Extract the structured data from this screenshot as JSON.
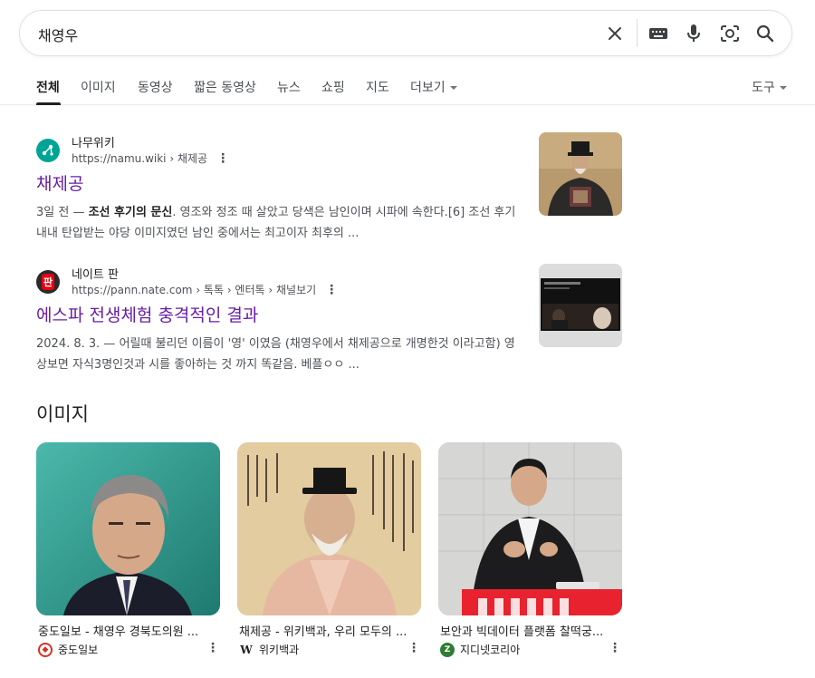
{
  "search": {
    "query": "채영우"
  },
  "tabs": [
    {
      "label": "전체"
    },
    {
      "label": "이미지"
    },
    {
      "label": "동영상"
    },
    {
      "label": "짧은 동영상"
    },
    {
      "label": "뉴스"
    },
    {
      "label": "쇼핑"
    },
    {
      "label": "지도"
    },
    {
      "label": "더보기"
    }
  ],
  "tools_label": "도구",
  "results": [
    {
      "site_name": "나무위키",
      "url": "https://namu.wiki › 채제공",
      "title": "채제공",
      "snippet_lead": "3일 전 — ",
      "snippet_bold": "조선 후기의 문신",
      "snippet_rest": ". 영조와 정조 때 살았고 당색은 남인이며 시파에 속한다.[6] 조선 후기 내내 탄압받는 야당 이미지였던 남인 중에서는 최고이자 최후의 ..."
    },
    {
      "site_name": "네이트 판",
      "url": "https://pann.nate.com › 톡톡 › 엔터톡 › 채널보기",
      "title": "에스파 전생체험 충격적인 결과",
      "snippet_lead": "2024. 8. 3. — ",
      "snippet_bold": "",
      "snippet_rest": "어릴때 불리던 이름이 '영' 이였음 (채영우에서 채제공으로 개명한것 이라고함) 영상보면 자식3명인것과 시를 좋아하는 것 까지 똑같음. 베플ㅇㅇ ..."
    }
  ],
  "images_section": {
    "heading": "이미지",
    "items": [
      {
        "caption": "중도일보 - 채영우 경북도의원 ...",
        "source": "중도일보"
      },
      {
        "caption": "채제공 - 위키백과, 우리 모두의 ...",
        "source": "위키백과"
      },
      {
        "caption": "보안과 빅데이터 플랫폼 찰떡궁...",
        "source": "지디넷코리아"
      }
    ]
  },
  "colors": {
    "visited_link": "#681da8",
    "snippet": "#4d5156",
    "border": "#dfe1e5"
  }
}
